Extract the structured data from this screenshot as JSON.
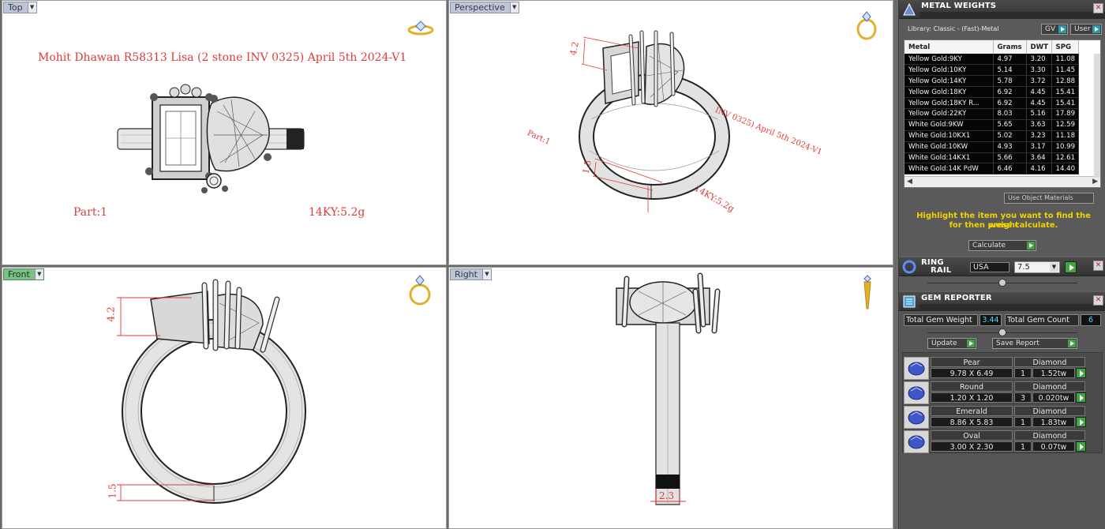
{
  "viewports": {
    "top": {
      "label": "Top",
      "title_text": "Mohit Dhawan R58313 Lisa (2 stone INV 0325) April 5th 2024-V1",
      "part": "Part:1",
      "weight": "14KY:5.2g"
    },
    "perspective": {
      "label": "Perspective",
      "dim_a": "4.2",
      "dim_b": "1.5",
      "part": "Part:1",
      "title_fragment": "INV 0325) April 5th 2024-V1",
      "weight": "14KY:5.2g"
    },
    "front": {
      "label": "Front",
      "dim_a": "4.2",
      "dim_b": "1.5"
    },
    "right": {
      "label": "Right",
      "dim_c": "2.3"
    }
  },
  "metal_weights": {
    "title": "METAL WEIGHTS",
    "library": "Library: Classic - (Fast)-Metal",
    "gv": "GV",
    "user": "User",
    "columns": [
      "Metal",
      "Grams",
      "DWT",
      "SPG"
    ],
    "rows": [
      [
        "Yellow Gold:9KY",
        "4.97",
        "3.20",
        "11.08"
      ],
      [
        "Yellow Gold:10KY",
        "5.14",
        "3.30",
        "11.45"
      ],
      [
        "Yellow Gold:14KY",
        "5.78",
        "3.72",
        "12.88"
      ],
      [
        "Yellow Gold:18KY",
        "6.92",
        "4.45",
        "15.41"
      ],
      [
        "Yellow Gold:18KY R...",
        "6.92",
        "4.45",
        "15.41"
      ],
      [
        "Yellow Gold:22KY",
        "8.03",
        "5.16",
        "17.89"
      ],
      [
        "White Gold:9KW",
        "5.65",
        "3.63",
        "12.59"
      ],
      [
        "White Gold:10KX1",
        "5.02",
        "3.23",
        "11.18"
      ],
      [
        "White Gold:10KW",
        "4.93",
        "3.17",
        "10.99"
      ],
      [
        "White Gold:14KX1",
        "5.66",
        "3.64",
        "12.61"
      ],
      [
        "White Gold:14K PdW",
        "6.46",
        "4.16",
        "14.40"
      ]
    ],
    "use_object_materials": "Use Object Materials",
    "highlight_line1": "Highlight the item you want to find the weight",
    "highlight_line2": "for then press calculate.",
    "calculate": "Calculate"
  },
  "ring_rail": {
    "title_line1": "RING",
    "title_line2": "RAIL",
    "region": "USA",
    "size": "7.5"
  },
  "gem_reporter": {
    "title": "GEM REPORTER",
    "total_weight_label": "Total Gem Weight",
    "total_weight": "3.44",
    "total_count_label": "Total Gem Count",
    "total_count": "6",
    "update": "Update",
    "save_report": "Save Report",
    "gems": [
      {
        "shape": "Pear",
        "size": "9.78 X 6.49",
        "type": "Diamond",
        "count": "1",
        "tw": "1.52tw"
      },
      {
        "shape": "Round",
        "size": "1.20 X 1.20",
        "type": "Diamond",
        "count": "3",
        "tw": "0.020tw"
      },
      {
        "shape": "Emerald",
        "size": "8.86 X 5.83",
        "type": "Diamond",
        "count": "1",
        "tw": "1.83tw"
      },
      {
        "shape": "Oval",
        "size": "3.00 X 2.30",
        "type": "Diamond",
        "count": "1",
        "tw": "0.07tw"
      }
    ]
  }
}
